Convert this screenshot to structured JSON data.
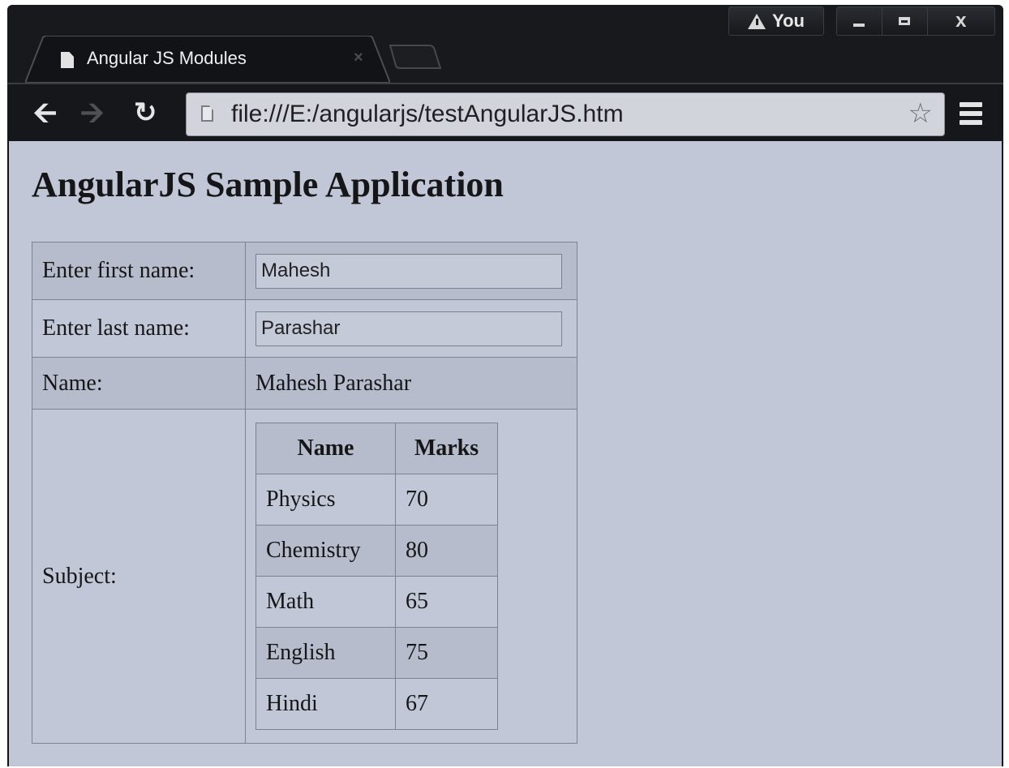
{
  "window": {
    "user_label": "You",
    "controls": [
      "minimize",
      "maximize",
      "close"
    ]
  },
  "tab": {
    "title": "Angular JS Modules",
    "close_glyph": "×"
  },
  "toolbar": {
    "url": "file:///E:/angularjs/testAngularJS.htm"
  },
  "page": {
    "heading": "AngularJS Sample Application",
    "first_name_label": "Enter first name:",
    "first_name_value": "Mahesh",
    "last_name_label": "Enter last name:",
    "last_name_value": "Parashar",
    "name_label": "Name:",
    "name_value": "Mahesh Parashar",
    "subject_label": "Subject:",
    "subjects_table": {
      "headers": [
        "Name",
        "Marks"
      ],
      "rows": [
        [
          "Physics",
          "70"
        ],
        [
          "Chemistry",
          "80"
        ],
        [
          "Math",
          "65"
        ],
        [
          "English",
          "75"
        ],
        [
          "Hindi",
          "67"
        ]
      ]
    }
  },
  "colors": {
    "frame": "#17191d",
    "page_background": "#c1c7d7",
    "row_shade": "#b6bccc"
  }
}
